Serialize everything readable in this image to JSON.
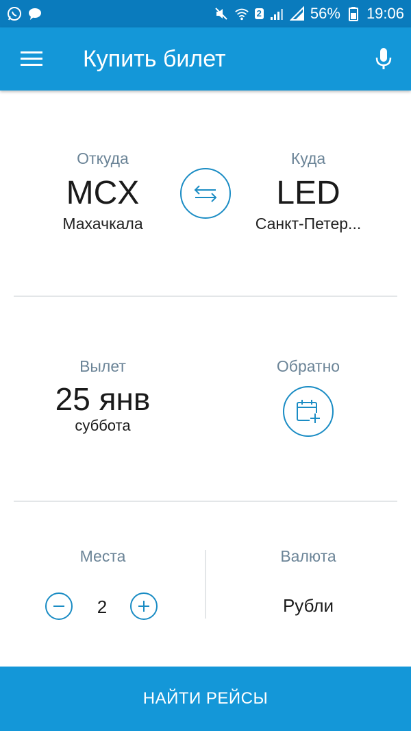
{
  "status_bar": {
    "battery_percent": "56%",
    "time": "19:06",
    "sim_badge": "2",
    "icons": [
      "whatsapp-icon",
      "chat-bubble-icon",
      "mute-icon",
      "wifi-icon",
      "signal-icon",
      "signal-icon",
      "battery-icon"
    ]
  },
  "app_bar": {
    "title": "Купить билет",
    "menu_icon": "hamburger-menu-icon",
    "mic_icon": "microphone-icon",
    "color": "#1497d8"
  },
  "route": {
    "from": {
      "label": "Откуда",
      "code": "MCX",
      "city": "Махачкала"
    },
    "to": {
      "label": "Куда",
      "code": "LED",
      "city": "Санкт-Петер..."
    },
    "swap_icon": "swap-arrows-icon"
  },
  "dates": {
    "departure": {
      "label": "Вылет",
      "date": "25 янв",
      "weekday": "суббота"
    },
    "return": {
      "label": "Обратно",
      "icon": "calendar-add-icon"
    }
  },
  "seats": {
    "label": "Места",
    "value": "2"
  },
  "currency": {
    "label": "Валюта",
    "value": "Рубли"
  },
  "cta": {
    "label": "НАЙТИ РЕЙСЫ"
  },
  "colors": {
    "accent": "#1497d8",
    "status": "#0a7bbd",
    "outline": "#1a8cc4",
    "muted_label": "#6b8497"
  }
}
